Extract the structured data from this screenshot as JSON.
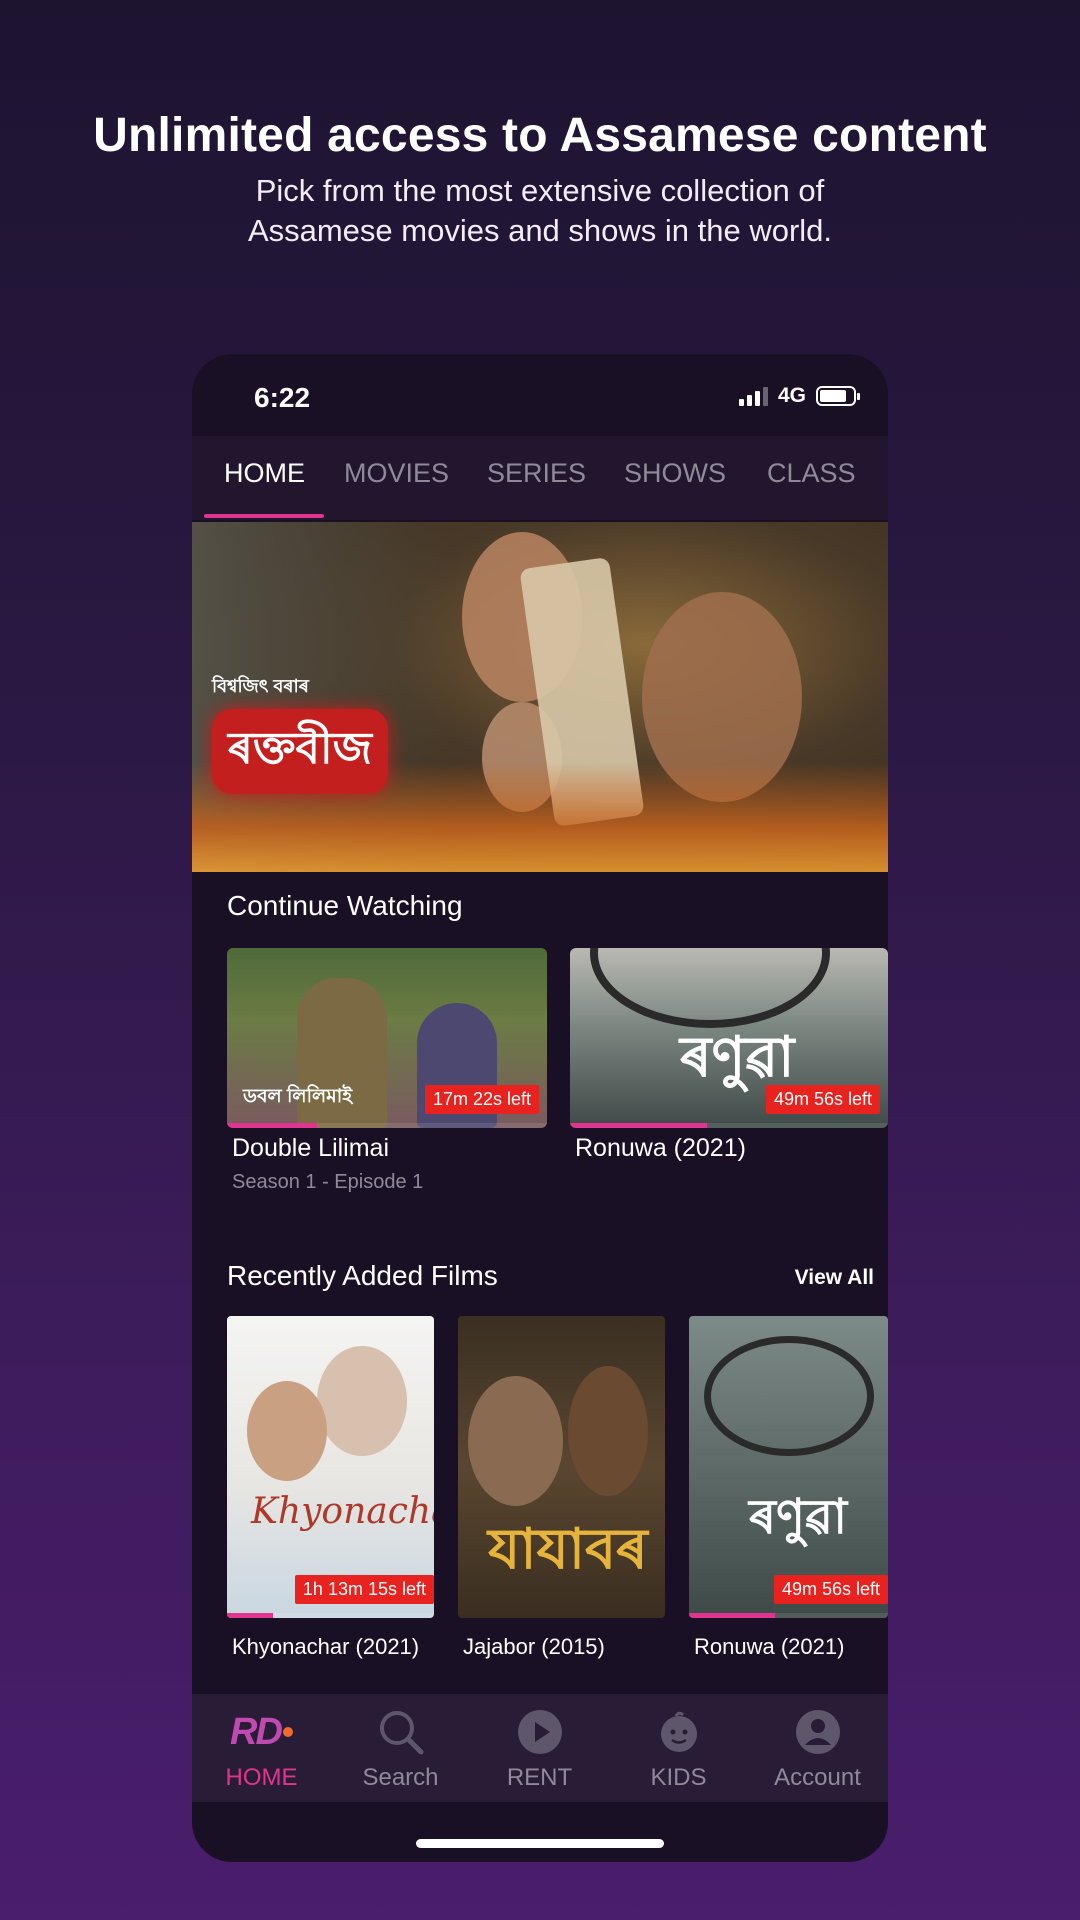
{
  "promo": {
    "title": "Unlimited access to Assamese content",
    "subtitle_line1": "Pick from the most extensive collection of",
    "subtitle_line2": "Assamese movies and shows in the world."
  },
  "status_bar": {
    "time": "6:22",
    "network": "4G"
  },
  "tabs": [
    {
      "label": "HOME",
      "active": true
    },
    {
      "label": "MOVIES",
      "active": false
    },
    {
      "label": "SERIES",
      "active": false
    },
    {
      "label": "SHOWS",
      "active": false
    },
    {
      "label": "CLASS",
      "active": false
    }
  ],
  "hero": {
    "small_text": "বিশ্বজিৎ বৰাৰ",
    "title_text": "ৰক্তবীজ"
  },
  "continue_watching": {
    "title": "Continue Watching",
    "items": [
      {
        "title": "Double Lilimai",
        "meta": "Season 1 - Episode 1",
        "time_left": "17m 22s left",
        "overlay": "ডবল লিলিমাই",
        "progress": 0.28
      },
      {
        "title": "Ronuwa (2021)",
        "meta": "",
        "time_left": "49m 56s left",
        "overlay": "ৰণুৱা",
        "progress": 0.43
      }
    ]
  },
  "recently_added": {
    "title": "Recently Added Films",
    "view_all": "View All",
    "items": [
      {
        "title": "Khyonachar (2021)",
        "time_left": "1h 13m 15s left",
        "overlay": "Khyonachar",
        "progress": 0.22
      },
      {
        "title": "Jajabor (2015)",
        "time_left": "",
        "overlay": "যাযাবৰ",
        "progress": 0
      },
      {
        "title": "Ronuwa (2021)",
        "time_left": "49m 56s left",
        "overlay": "ৰণুৱা",
        "progress": 0.43
      }
    ]
  },
  "bottom_nav": [
    {
      "label": "HOME",
      "icon": "rd-logo-icon",
      "active": true
    },
    {
      "label": "Search",
      "icon": "search-icon",
      "active": false
    },
    {
      "label": "RENT",
      "icon": "play-icon",
      "active": false
    },
    {
      "label": "KIDS",
      "icon": "kids-icon",
      "active": false
    },
    {
      "label": "Account",
      "icon": "account-icon",
      "active": false
    }
  ],
  "colors": {
    "accent": "#e0348e",
    "badge": "#e8221f",
    "background": "#1a1025"
  }
}
